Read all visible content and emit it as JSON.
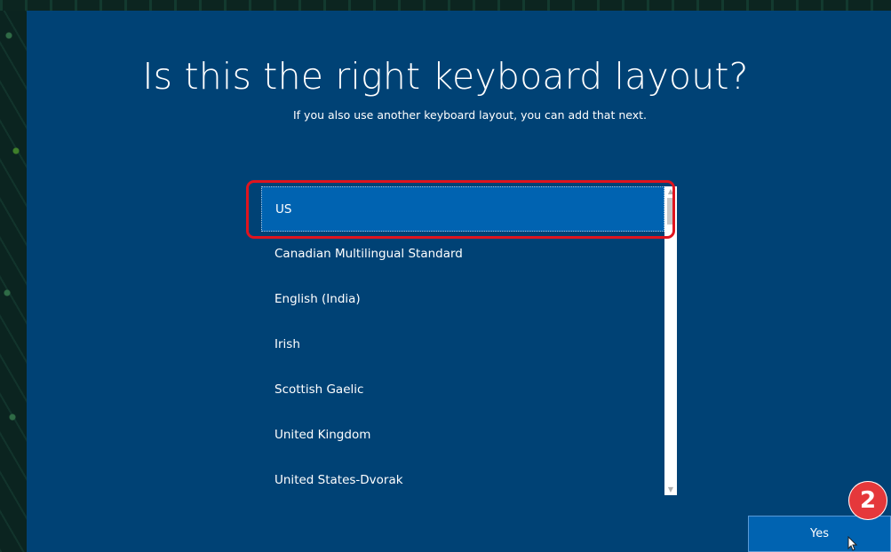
{
  "header": {
    "title": "Is this the right keyboard layout?",
    "subtitle": "If you also use another keyboard layout, you can add that next."
  },
  "layout_list": {
    "items": [
      {
        "label": "US",
        "selected": true
      },
      {
        "label": "Canadian Multilingual Standard",
        "selected": false
      },
      {
        "label": "English (India)",
        "selected": false
      },
      {
        "label": "Irish",
        "selected": false
      },
      {
        "label": "Scottish Gaelic",
        "selected": false
      },
      {
        "label": "United Kingdom",
        "selected": false
      },
      {
        "label": "United States-Dvorak",
        "selected": false
      }
    ]
  },
  "scrollbar": {
    "up_icon": "chevron-up-icon",
    "down_icon": "chevron-down-icon"
  },
  "footer": {
    "yes_label": "Yes"
  },
  "annotation": {
    "step_number": "2",
    "highlight_color": "#e0141e"
  },
  "colors": {
    "background": "#004275",
    "selected": "#0063b1",
    "badge": "#e5383b"
  }
}
